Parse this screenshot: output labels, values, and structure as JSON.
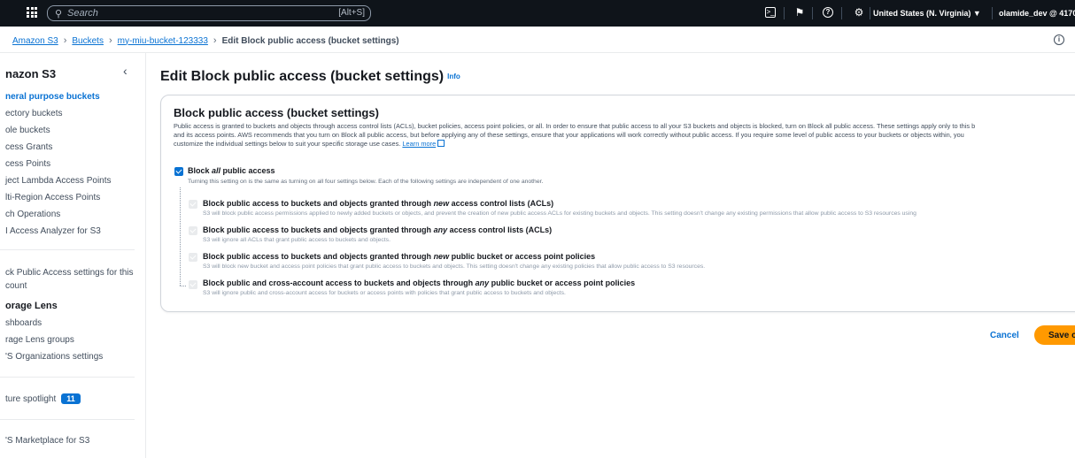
{
  "topnav": {
    "search_placeholder": "Search",
    "search_shortcut": "[Alt+S]",
    "region": "United States (N. Virginia) ▼",
    "user": "olamide_dev @ 4170-"
  },
  "breadcrumbs": {
    "items": [
      "Amazon S3",
      "Buckets",
      "my-miu-bucket-123333"
    ],
    "current": "Edit Block public access (bucket settings)"
  },
  "sidebar": {
    "title": "nazon S3",
    "items": [
      "neral purpose buckets",
      "ectory buckets",
      "ole buckets",
      "cess Grants",
      "cess Points",
      "ject Lambda Access Points",
      "lti-Region Access Points",
      "ch Operations",
      "I Access Analyzer for S3"
    ],
    "block_public": [
      "ck Public Access settings for this",
      "count"
    ],
    "storage_lens_title": "orage Lens",
    "storage_lens_items": [
      "shboards",
      "rage Lens groups",
      "'S Organizations settings"
    ],
    "feature_spotlight": "ture spotlight",
    "feature_count": "11",
    "marketplace": "'S Marketplace for S3"
  },
  "main": {
    "title": "Edit Block public access (bucket settings)",
    "info": "Info",
    "panel_title": "Block public access (bucket settings)",
    "desc_lines": [
      "Public access is granted to buckets and objects through access control lists (ACLs), bucket policies, access point policies, or all. In order to ensure that public access to all your S3 buckets and objects is blocked, turn on Block all public access. These settings apply only to this b",
      "and its access points. AWS recommends that you turn on Block all public access, but before applying any of these settings, ensure that your applications will work correctly without public access. If you require some level of public access to your buckets or objects within, you",
      "customize the individual settings below to suit your specific storage use cases."
    ],
    "learn_more": "Learn more",
    "block_all": {
      "prefix": "Block ",
      "em": "all",
      "suffix": " public access",
      "desc": "Turning this setting on is the same as turning on all four settings below. Each of the following settings are independent of one another."
    },
    "options": [
      {
        "pre": "Block public access to buckets and objects granted through ",
        "em": "new",
        "post": " access control lists (ACLs)",
        "desc": "S3 will block public access permissions applied to newly added buckets or objects, and prevent the creation of new public access ACLs for existing buckets and objects. This setting doesn't change any existing permissions that allow public access to S3 resources using"
      },
      {
        "pre": "Block public access to buckets and objects granted through ",
        "em": "any",
        "post": " access control lists (ACLs)",
        "desc": "S3 will ignore all ACLs that grant public access to buckets and objects."
      },
      {
        "pre": "Block public access to buckets and objects granted through ",
        "em": "new",
        "post": " public bucket or access point policies",
        "desc": "S3 will block new bucket and access point policies that grant public access to buckets and objects. This setting doesn't change any existing policies that allow public access to S3 resources."
      },
      {
        "pre": "Block public and cross-account access to buckets and objects through ",
        "em": "any",
        "post": " public bucket or access point policies",
        "desc": "S3 will ignore public and cross-account access for buckets or access points with policies that grant public access to buckets and objects."
      }
    ],
    "cancel": "Cancel",
    "save": "Save c"
  }
}
